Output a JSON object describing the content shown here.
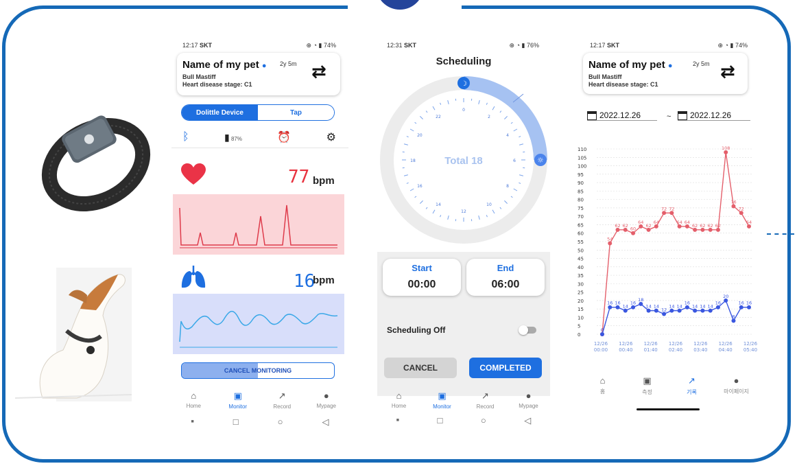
{
  "phone1": {
    "status_time": "12:17",
    "carrier": "SKT",
    "battery": "74%",
    "pet": {
      "name": "Name of my pet",
      "age": "2y 5m",
      "breed": "Bull Mastiff",
      "disease": "Heart disease stage: C1"
    },
    "tabs": {
      "device": "Dolittle Device",
      "tap": "Tap"
    },
    "device_battery": "87%",
    "heart_rate": "77",
    "resp_rate": "16",
    "unit": "bpm",
    "cancel_button": "CANCEL MONITORING",
    "monitoring_progress": 0.5,
    "nav": [
      "Home",
      "Monitor",
      "Record",
      "Mypage"
    ],
    "active_nav": "Monitor"
  },
  "phone2": {
    "status_time": "12:31",
    "carrier": "SKT",
    "battery": "76%",
    "title": "Scheduling",
    "total_label": "Total 18",
    "clock_hours": [
      "0",
      "2",
      "4",
      "6",
      "8",
      "10",
      "12",
      "14",
      "16",
      "18",
      "20",
      "22"
    ],
    "start_label": "Start",
    "start_value": "00:00",
    "end_label": "End",
    "end_value": "06:00",
    "schedule_toggle_label": "Scheduling Off",
    "cancel_button": "CANCEL",
    "completed_button": "COMPLETED",
    "nav": [
      "Home",
      "Monitor",
      "Record",
      "Mypage"
    ],
    "active_nav": "Monitor"
  },
  "phone3": {
    "status_time": "12:17",
    "carrier": "SKT",
    "battery": "74%",
    "pet": {
      "name": "Name of my pet",
      "age": "2y 5m",
      "breed": "Bull Mastiff",
      "disease": "Heart disease stage: C1"
    },
    "date_from": "2022.12.26",
    "date_sep": "~",
    "date_to": "2022.12.26",
    "nav": [
      "홈",
      "측정",
      "기록",
      "마이페이지"
    ],
    "active_nav": "기록"
  },
  "colors": {
    "frame": "#1569b7",
    "accent": "#1e6fe0",
    "heart": "#e8323f",
    "heart_series": "#e45f6b",
    "resp_series": "#3a57e0"
  },
  "chart_data": {
    "type": "line",
    "ylim": [
      0,
      110
    ],
    "yticks": [
      0,
      5,
      10,
      15,
      20,
      25,
      30,
      35,
      40,
      45,
      50,
      55,
      60,
      65,
      70,
      75,
      80,
      85,
      90,
      95,
      100,
      105,
      110
    ],
    "x_labels": [
      {
        "date": "12/26",
        "time": "00:00"
      },
      {
        "date": "12/26",
        "time": "00:40"
      },
      {
        "date": "12/26",
        "time": "01:40"
      },
      {
        "date": "12/26",
        "time": "02:40"
      },
      {
        "date": "12/26",
        "time": "03:40"
      },
      {
        "date": "12/26",
        "time": "04:40"
      },
      {
        "date": "12/26",
        "time": "05:40"
      }
    ],
    "series": [
      {
        "values": [
          0,
          54,
          62,
          62,
          60,
          64,
          62,
          64,
          72,
          72,
          64,
          64,
          62,
          62,
          62,
          62,
          108,
          76,
          72,
          64
        ]
      },
      {
        "values": [
          0,
          16,
          16,
          14,
          16,
          18,
          14,
          14,
          12,
          14,
          14,
          16,
          14,
          14,
          14,
          16,
          20,
          8,
          16,
          16
        ]
      }
    ]
  }
}
